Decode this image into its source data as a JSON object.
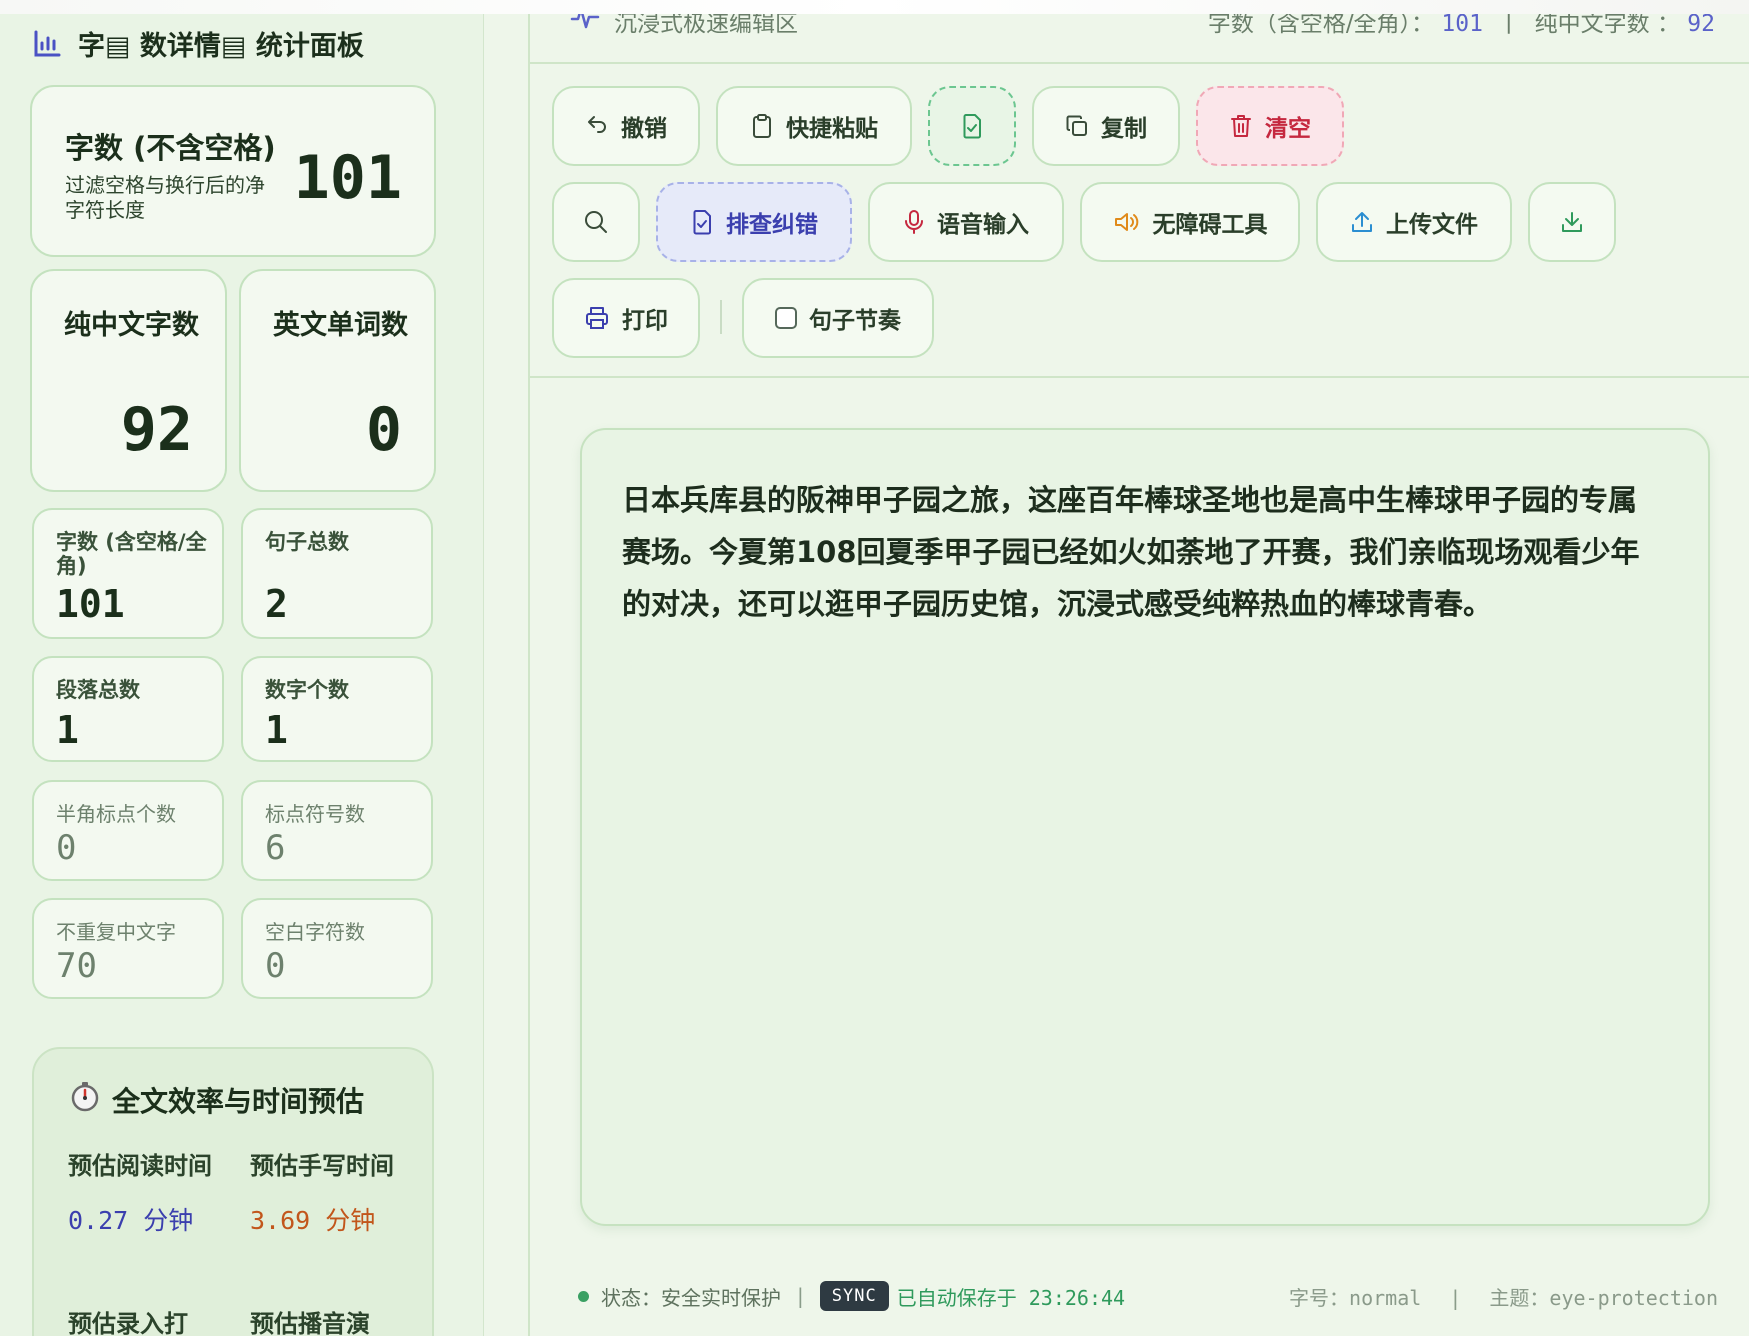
{
  "sidebar": {
    "title": "字▤ 数详情▤ 统计面板",
    "title_icon": "bar-chart-icon",
    "main_card": {
      "title": "字数 (不含空格)",
      "subtitle": "过滤空格与换行后的净字符长度",
      "value": "101"
    },
    "chinese_chars": {
      "title": "纯中文字数",
      "value": "92"
    },
    "english_words": {
      "title": "英文单词数",
      "value": "0"
    },
    "stats": [
      {
        "title": "字数 (含空格/全角)",
        "value": "101"
      },
      {
        "title": "句子总数",
        "value": "2"
      },
      {
        "title": "段落总数",
        "value": "1"
      },
      {
        "title": "数字个数",
        "value": "1"
      },
      {
        "title": "半角标点个数",
        "value": "0"
      },
      {
        "title": "标点符号数",
        "value": "6"
      },
      {
        "title": "不重复中文字",
        "value": "70"
      },
      {
        "title": "空白字符数",
        "value": "0"
      }
    ],
    "efficiency": {
      "icon": "stopwatch-icon",
      "title": "全文效率与时间预估",
      "items": [
        {
          "label": "预估阅读时间",
          "value": "0.27 分钟",
          "color": "#3b3fae"
        },
        {
          "label": "预估手写时间",
          "value": "3.69 分钟",
          "color": "#c2561b"
        },
        {
          "label": "预估录入打",
          "value": "",
          "color": "#2b432b"
        },
        {
          "label": "预估播音演",
          "value": "",
          "color": "#2b432b"
        }
      ]
    }
  },
  "header": {
    "left_label": "沉浸式极速编辑区",
    "chars_label": "字数（含空格/全角）：",
    "chars_value": "101",
    "divider": "|",
    "chinese_label": "纯中文字数 ：",
    "chinese_value": "92"
  },
  "toolbar": {
    "undo": "撤销",
    "paste": "快捷粘贴",
    "copy": "复制",
    "clear": "清空",
    "proofread": "排查纠错",
    "voice": "语音输入",
    "accessibility": "无障碍工具",
    "upload": "上传文件",
    "print": "打印",
    "rhythm": "句子节奏"
  },
  "editor": {
    "content": "日本兵库县的阪神甲子园之旅，这座百年棒球圣地也是高中生棒球甲子园的专属赛场。今夏第108回夏季甲子园已经如火如荼地了开赛，我们亲临现场观看少年的对决，还可以逛甲子园历史馆，沉浸式感受纯粹热血的棒球青春。"
  },
  "status": {
    "state_label": "状态：安全实时保护",
    "divider": "|",
    "sync_badge": "SYNC",
    "saved_text": "已自动保存于 23:26:44",
    "font_size_label": "字号：normal",
    "theme_label": "主题：eye-protection"
  },
  "colors": {
    "accent_indigo": "#3b3fae",
    "danger": "#c5283f",
    "success": "#2f9a5c",
    "card_border": "#c4e2bf"
  }
}
